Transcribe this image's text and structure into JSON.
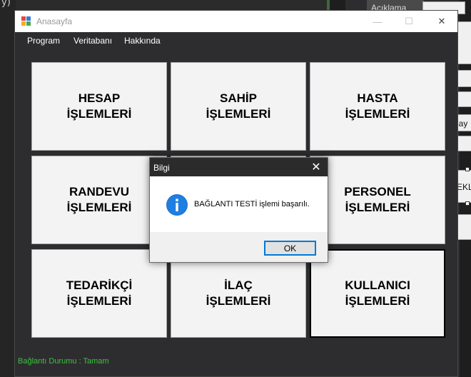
{
  "window": {
    "title": "Anasayfa",
    "minimize": "—",
    "maximize": "☐",
    "close": "✕"
  },
  "menu": {
    "items": [
      "Program",
      "Veritabanı",
      "Hakkında"
    ]
  },
  "tiles": [
    {
      "label": "HESAP\nİŞLEMLERİ"
    },
    {
      "label": "SAHİP\nİŞLEMLERİ"
    },
    {
      "label": "HASTA\nİŞLEMLERİ"
    },
    {
      "label": "RANDEVU\nİŞLEMLERİ"
    },
    {
      "label": "PERSONEL\nİŞLEMLERİ"
    },
    {
      "label": "TEDARİKÇİ\nİŞLEMLERİ"
    },
    {
      "label": "İLAÇ\nİŞLEMLERİ"
    },
    {
      "label": "KULLANICI\nİŞLEMLERİ"
    }
  ],
  "status": {
    "text": "Bağlantı Durumu : Tamam",
    "color": "#3ac43a"
  },
  "dialog": {
    "title": "Bilgi",
    "close": "✕",
    "message": "BAĞLANTI TESTİ işlemi başarılı.",
    "ok_label": "OK",
    "icon": "info-icon",
    "accent": "#0078d7"
  },
  "background": {
    "left_char": "y)",
    "right_label": "Açıklama",
    "right_clip_1": "lay",
    "right_clip_2": "EKL"
  }
}
